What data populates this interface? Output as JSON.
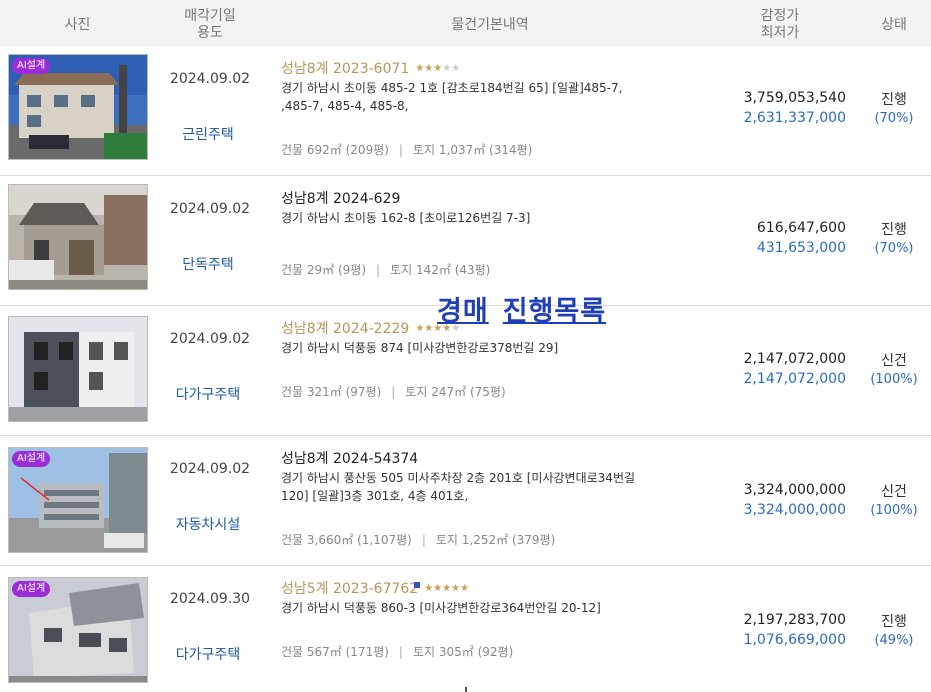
{
  "header": {
    "photo": "사진",
    "sale_date_line1": "매각기일",
    "sale_date_line2": "용도",
    "basic_info": "물건기본내역",
    "price_line1": "감정가",
    "price_line2": "최저가",
    "status": "상태"
  },
  "overlay_title": {
    "word1": "경매",
    "word2": "진행목록"
  },
  "rows": [
    {
      "ai_badge": "AI설계",
      "date": "2024.09.02",
      "usage": "근린주택",
      "case": "성남8계 2023-6071",
      "case_style": "gold",
      "stars": 3,
      "address_line1": "경기 하남시 초이동 485-2 1호 [감초로184번길 65] [일괄]485-7,",
      "address_line2": ",485-7, 485-4, 485-8,",
      "building_area": "건물 692㎡ (209평)",
      "land_area": "토지 1,037㎡ (314평)",
      "appraisal": "3,759,053,540",
      "minimum": "2,631,337,000",
      "status": "진행",
      "percent": "(70%)"
    },
    {
      "ai_badge": "",
      "date": "2024.09.02",
      "usage": "단독주택",
      "case": "성남8계 2024-629",
      "case_style": "black",
      "stars": 0,
      "address_line1": "경기 하남시 초이동 162-8 [초이로126번길 7-3]",
      "address_line2": "",
      "building_area": "건물 29㎡ (9평)",
      "land_area": "토지 142㎡ (43평)",
      "appraisal": "616,647,600",
      "minimum": "431,653,000",
      "status": "진행",
      "percent": "(70%)"
    },
    {
      "ai_badge": "",
      "date": "2024.09.02",
      "usage": "다가구주택",
      "case": "성남8계 2024-2229",
      "case_style": "gold",
      "stars": 4,
      "address_line1": "경기 하남시 덕풍동 874 [미사강변한강로378번길 29]",
      "address_line2": "",
      "building_area": "건물 321㎡ (97평)",
      "land_area": "토지 247㎡ (75평)",
      "appraisal": "2,147,072,000",
      "minimum": "2,147,072,000",
      "status": "신건",
      "percent": "(100%)"
    },
    {
      "ai_badge": "AI설계",
      "date": "2024.09.02",
      "usage": "자동차시설",
      "case": "성남8계 2024-54374",
      "case_style": "black",
      "stars": 0,
      "address_line1": "경기 하남시 풍산동 505 미사주차장 2층 201호 [미사강변대로34번길",
      "address_line2": "120] [일괄]3층 301호, 4층 401호,",
      "building_area": "건물 3,660㎡ (1,107평)",
      "land_area": "토지 1,252㎡ (379평)",
      "appraisal": "3,324,000,000",
      "minimum": "3,324,000,000",
      "status": "신건",
      "percent": "(100%)"
    },
    {
      "ai_badge": "AI설계",
      "date": "2024.09.30",
      "usage": "다가구주택",
      "case": "성남5계 2023-67762",
      "case_style": "gold",
      "stars": 5,
      "address_line1": "경기 하남시 덕풍동 860-3 [미사강변한강로364번안길 20-12]",
      "address_line2": "",
      "building_area": "건물 567㎡ (171평)",
      "land_area": "토지 305㎡ (92평)",
      "appraisal": "2,197,283,700",
      "minimum": "1,076,669,000",
      "status": "진행",
      "percent": "(49%)"
    }
  ]
}
